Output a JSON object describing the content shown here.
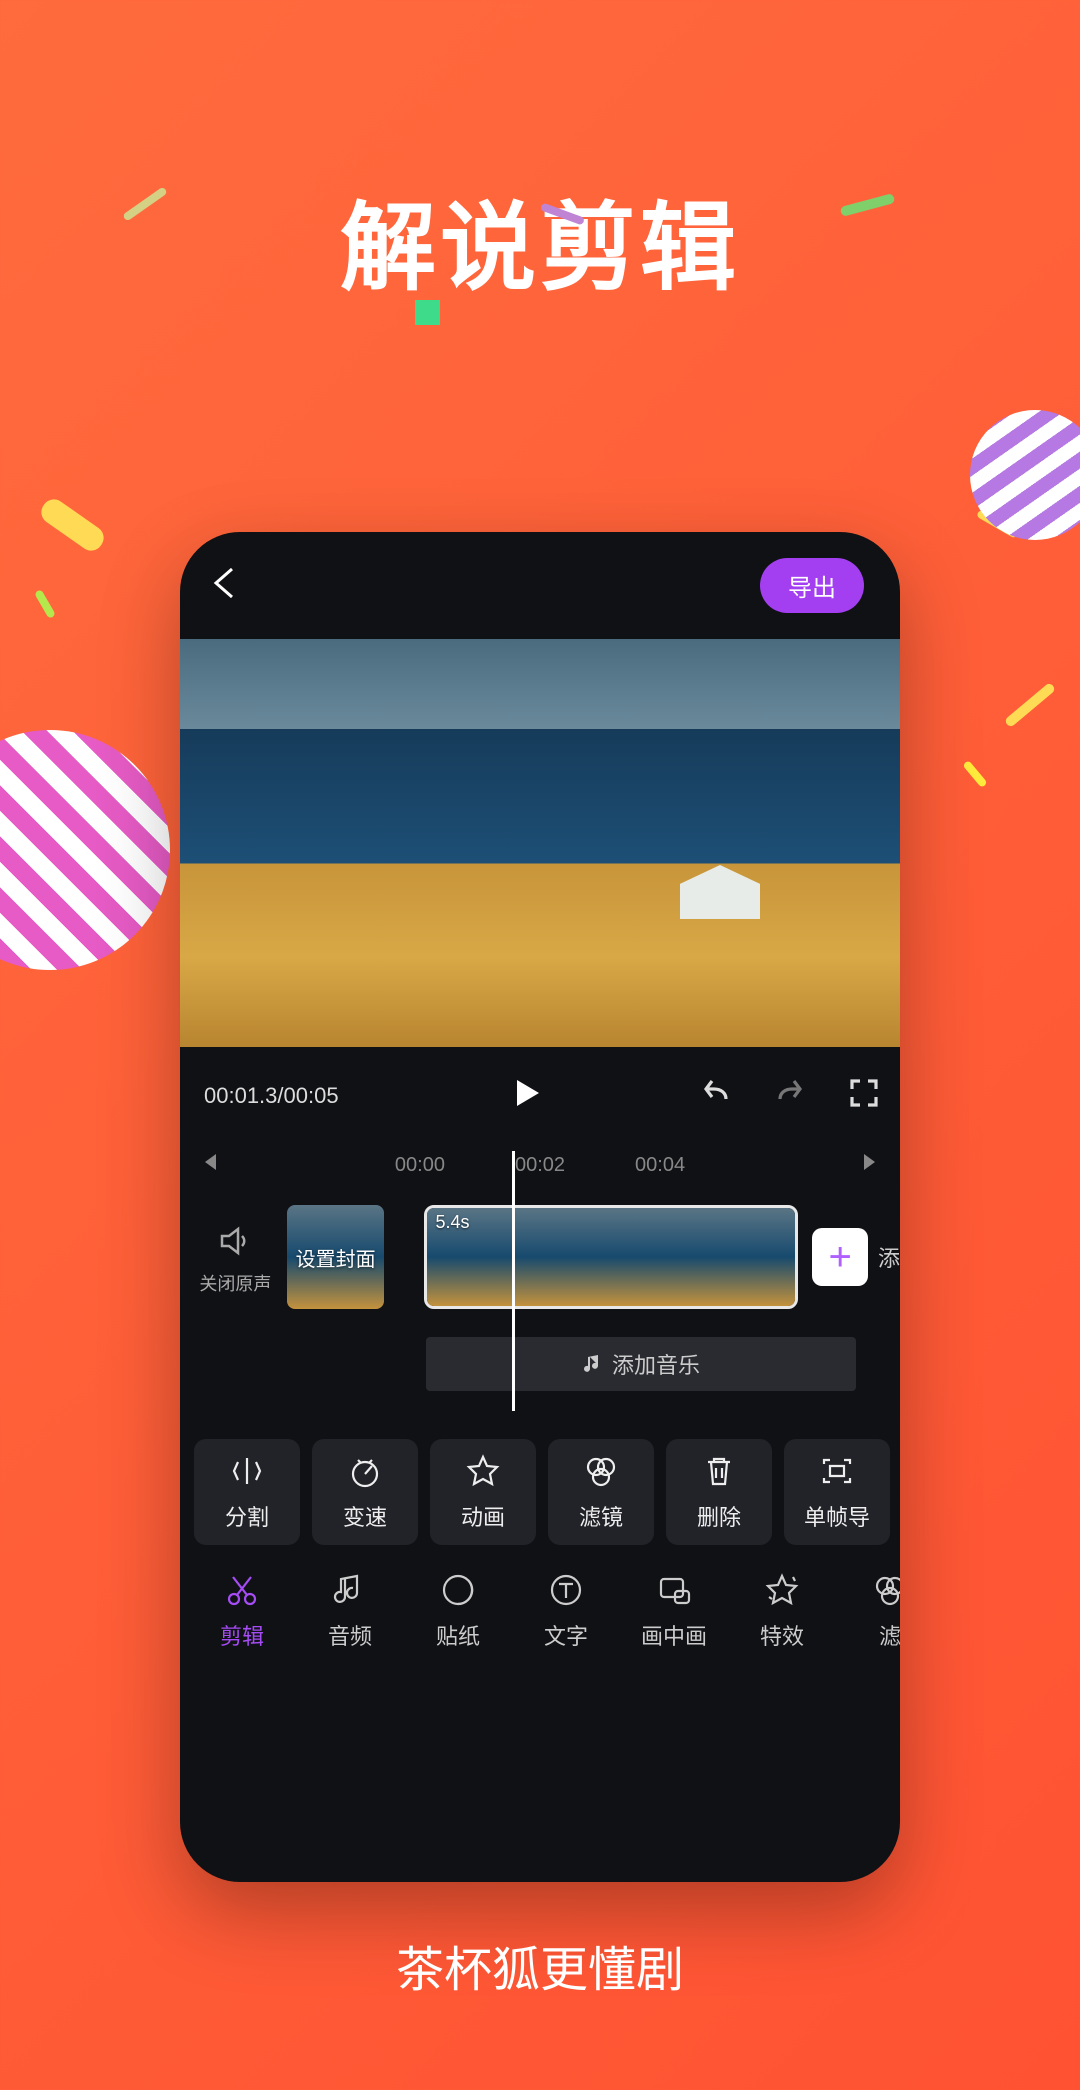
{
  "promo": {
    "title": "解说剪辑",
    "subtitle": "茶杯狐更懂剧"
  },
  "topbar": {
    "export_label": "导出"
  },
  "player": {
    "time_text": "00:01.3/00:05"
  },
  "ruler": {
    "t0": "00:00",
    "t1": "00:02",
    "t2": "00:04"
  },
  "timeline": {
    "mute_label": "关闭原声",
    "cover_label": "设置封面",
    "clip_duration": "5.4s",
    "add_label": "添"
  },
  "music": {
    "label": "添加音乐"
  },
  "tools": [
    {
      "label": "分割"
    },
    {
      "label": "变速"
    },
    {
      "label": "动画"
    },
    {
      "label": "滤镜"
    },
    {
      "label": "删除"
    },
    {
      "label": "单帧导"
    }
  ],
  "tabs": [
    {
      "label": "剪辑"
    },
    {
      "label": "音频"
    },
    {
      "label": "贴纸"
    },
    {
      "label": "文字"
    },
    {
      "label": "画中画"
    },
    {
      "label": "特效"
    },
    {
      "label": "滤"
    }
  ]
}
